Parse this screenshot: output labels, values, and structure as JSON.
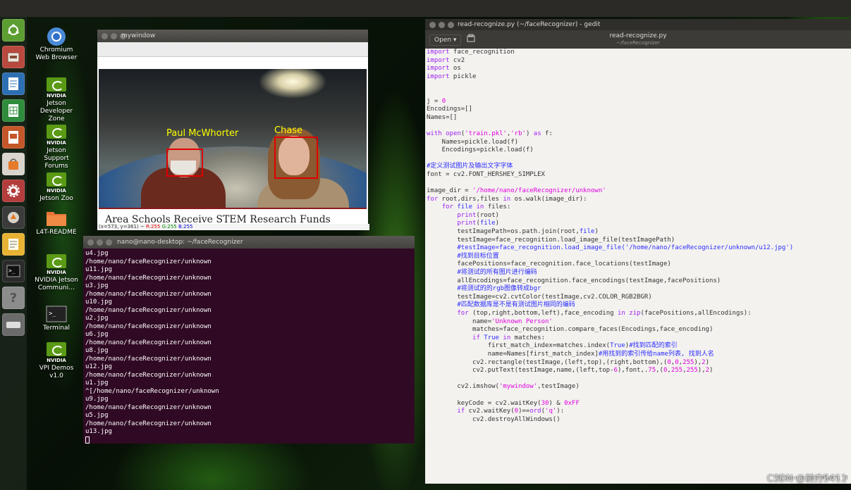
{
  "desktop": {
    "icons": [
      {
        "label": "Chromium Web Browser",
        "icon": "chromium-icon"
      },
      {
        "label": "Jetson Developer Zone",
        "icon": "nvidia-icon"
      },
      {
        "label": "Jetson Support Forums",
        "icon": "nvidia-icon"
      },
      {
        "label": "Jetson Zoo",
        "icon": "nvidia-icon"
      },
      {
        "label": "L4T-README",
        "icon": "folder-icon"
      },
      {
        "label": "NVIDIA Jetson Communi…",
        "icon": "nvidia-icon"
      },
      {
        "label": "Terminal",
        "icon": "terminal-icon"
      },
      {
        "label": "VPI Demos v1.0",
        "icon": "nvidia-icon"
      }
    ],
    "nvidia_text": "NVIDIA",
    "watermark": "CSDN @前方5411"
  },
  "launcher": {
    "items": [
      "ubuntu-icon",
      "files-icon",
      "writer-icon",
      "calc-icon",
      "impress-icon",
      "software-icon",
      "settings-icon",
      "updater-icon",
      "text-editor-icon",
      "terminal-icon",
      "help-icon",
      "drive-icon"
    ]
  },
  "mywindow": {
    "title": "mywindow",
    "faces": [
      "Paul McWhorter",
      "Chase"
    ],
    "caption": "Area Schools Receive STEM Research Funds",
    "status_coords": "(x=573, y=361) ~ ",
    "status_r": "R:255",
    "status_g": "G:255",
    "status_b": "B:255"
  },
  "terminal": {
    "title": "nano@nano-desktop: ~/faceRecognizer",
    "lines": [
      "u4.jpg",
      "/home/nano/faceRecognizer/unknown",
      "u11.jpg",
      "/home/nano/faceRecognizer/unknown",
      "u3.jpg",
      "/home/nano/faceRecognizer/unknown",
      "u10.jpg",
      "/home/nano/faceRecognizer/unknown",
      "u2.jpg",
      "/home/nano/faceRecognizer/unknown",
      "u6.jpg",
      "/home/nano/faceRecognizer/unknown",
      "u8.jpg",
      "/home/nano/faceRecognizer/unknown",
      "u12.jpg",
      "/home/nano/faceRecognizer/unknown",
      "u1.jpg",
      "^[/home/nano/faceRecognizer/unknown",
      "u9.jpg",
      "/home/nano/faceRecognizer/unknown",
      "u5.jpg",
      "/home/nano/faceRecognizer/unknown",
      "u13.jpg"
    ]
  },
  "gedit": {
    "window_title": "read-recognize.py (~/faceRecognizer) - gedit",
    "open_label": "Open",
    "doc_title": "read-recognize.py",
    "doc_path": "~/faceRecognizer",
    "statusbar": "Python ▾  Tab Width: 8"
  }
}
